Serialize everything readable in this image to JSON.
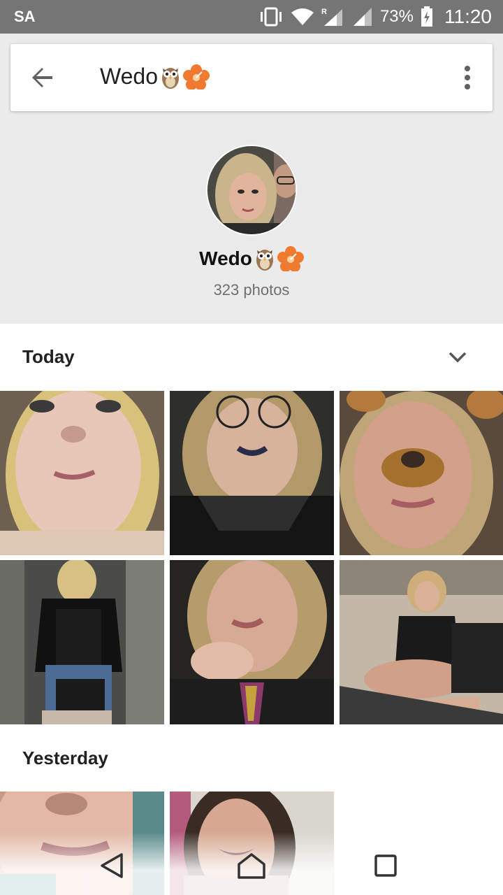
{
  "status_bar": {
    "carrier": "SA",
    "battery": "73%",
    "time": "11:20",
    "icons": [
      "vibrate-icon",
      "wifi-icon",
      "signal-roaming-icon",
      "signal-icon",
      "battery-charging-icon"
    ]
  },
  "app_bar": {
    "title": "Wedo",
    "title_emojis": [
      "owl",
      "hibiscus"
    ],
    "back_icon": "arrow-back-icon",
    "menu_icon": "more-vert-icon"
  },
  "profile": {
    "name": "Wedo",
    "photo_count": "323 photos"
  },
  "sections": [
    {
      "label": "Today",
      "photo_count": 6
    },
    {
      "label": "Yesterday",
      "photo_count": 2
    }
  ],
  "nav_bar": {
    "icons": [
      "back-triangle-icon",
      "home-icon",
      "recents-icon"
    ]
  },
  "colors": {
    "status_bar": "#757575",
    "header_background": "#ebebeb",
    "emoji_flower": "#f08a3a",
    "emoji_owl": "#8a6a4a"
  }
}
